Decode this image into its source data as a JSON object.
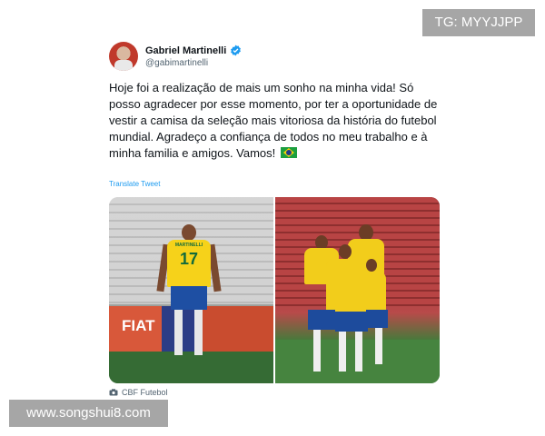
{
  "watermarks": {
    "top": "TG: MYYJJPP",
    "bottom": "www.songshui8.com"
  },
  "tweet": {
    "author_name": "Gabriel Martinelli",
    "author_handle": "@gabimartinelli",
    "text": "Hoje foi a realização de mais um sonho na minha vida! Só posso agradecer por esse momento, por ter a oportunidade de vestir a camisa da seleção mais vitoriosa da história do futebol mundial. Agradeço a confiança de todos no meu trabalho e à minha familia e amigos. Vamos!",
    "translate_label": "Translate Tweet",
    "media_source": "CBF Futebol",
    "photo_left": {
      "jersey_name": "MARTINELLI",
      "jersey_number": "17",
      "board_text": "FIAT"
    }
  },
  "icons": {
    "verified": "verified-badge-icon",
    "flag": "brazil-flag-icon",
    "source": "camera-icon"
  },
  "colors": {
    "link": "#1d9bf0",
    "verified": "#1d9bf0",
    "watermark_bg": "#a6a6a6"
  }
}
